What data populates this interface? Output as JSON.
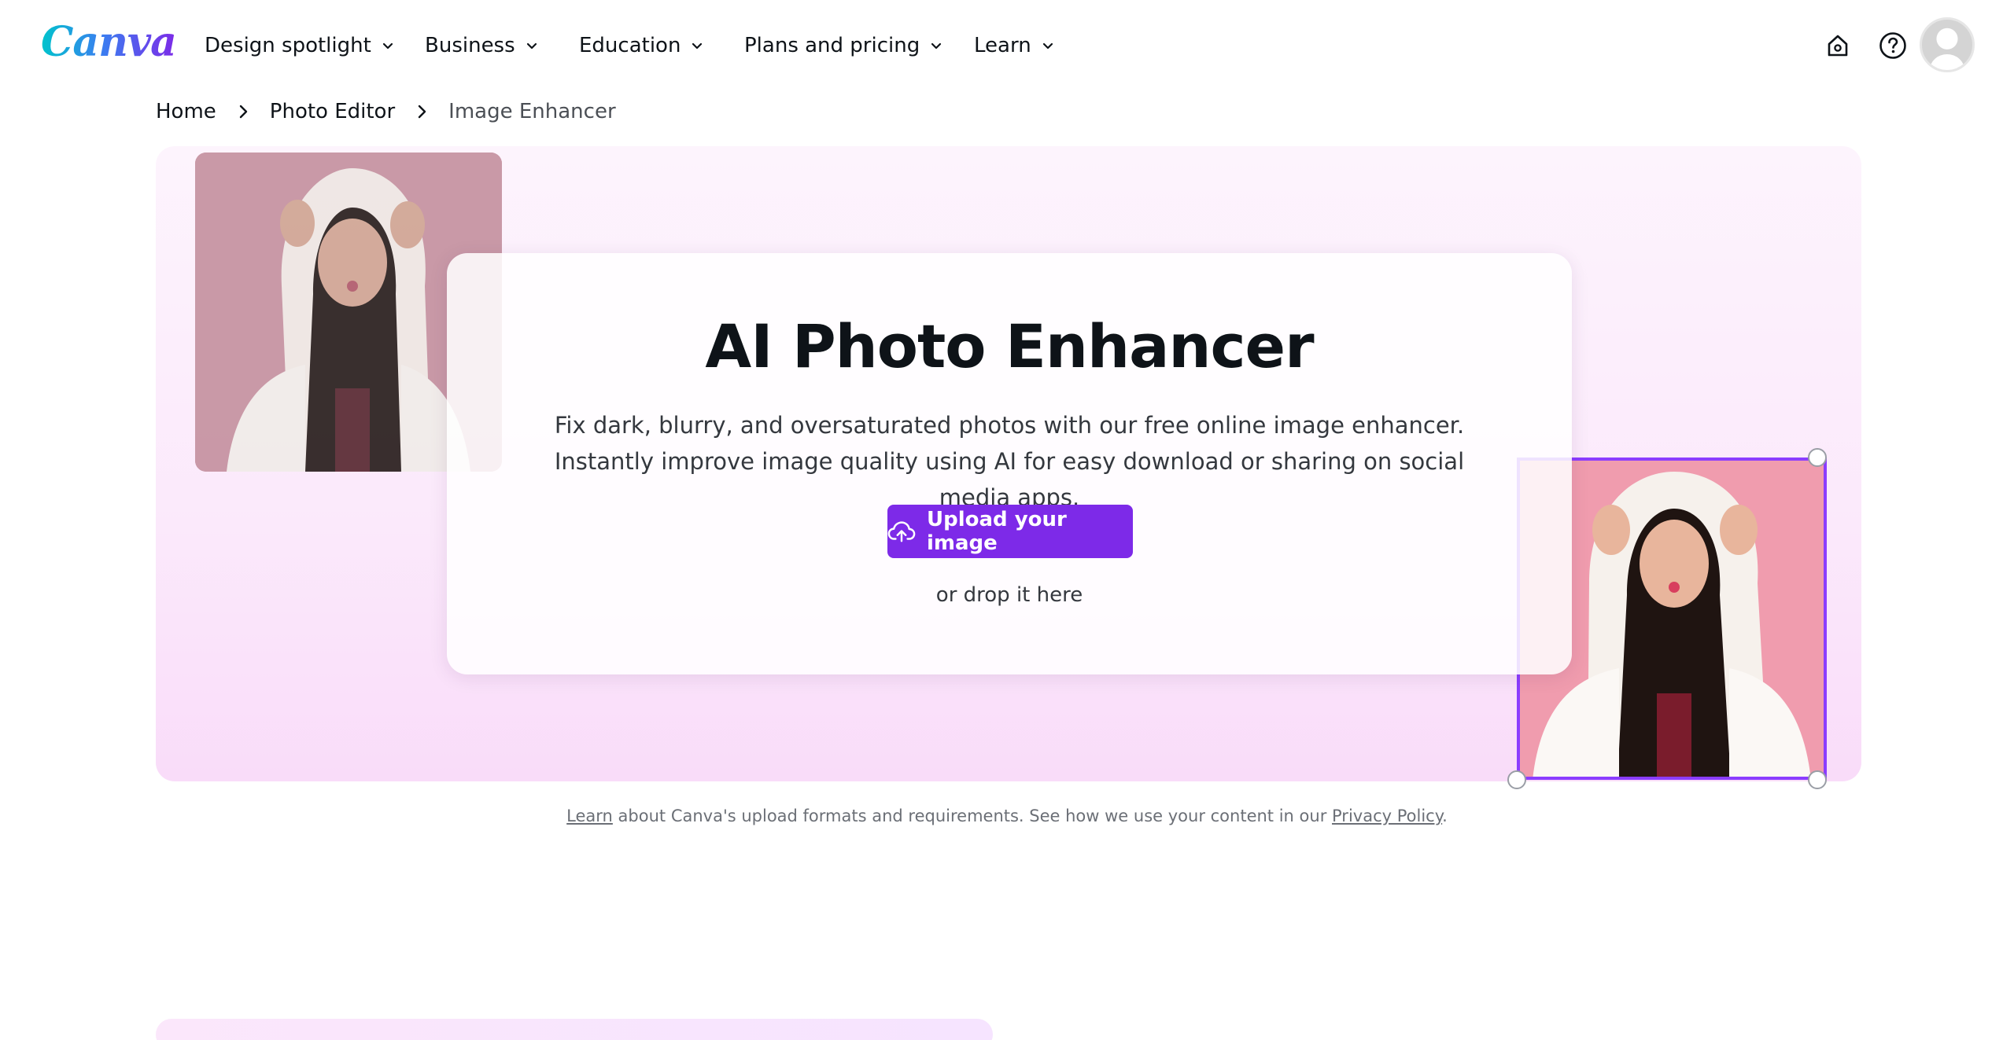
{
  "brand": {
    "logo_text": "Canva"
  },
  "nav": {
    "items": [
      {
        "label": "Design spotlight"
      },
      {
        "label": "Business"
      },
      {
        "label": "Education"
      },
      {
        "label": "Plans and pricing"
      },
      {
        "label": "Learn"
      }
    ],
    "icons": [
      "home-icon",
      "help-icon"
    ],
    "avatar": "avatar"
  },
  "breadcrumb": [
    {
      "label": "Home"
    },
    {
      "label": "Photo Editor"
    },
    {
      "label": "Image Enhancer"
    }
  ],
  "hero": {
    "title": "AI Photo Enhancer",
    "description": "Fix dark, blurry, and oversaturated photos with our free online image enhancer. Instantly improve image quality using AI for easy download or sharing on social media apps.",
    "upload_label": "Upload your image",
    "drop_text": "or drop it here"
  },
  "footnote": {
    "learn_link": "Learn",
    "middle": " about Canva's upload formats and requirements. See how we use your content in our ",
    "privacy_link": "Privacy Policy",
    "end": "."
  },
  "colors": {
    "accent": "#7d2ae8",
    "selection": "#8b3dff",
    "hero_bg": "#fbe9fb",
    "text": "#0e1318"
  }
}
